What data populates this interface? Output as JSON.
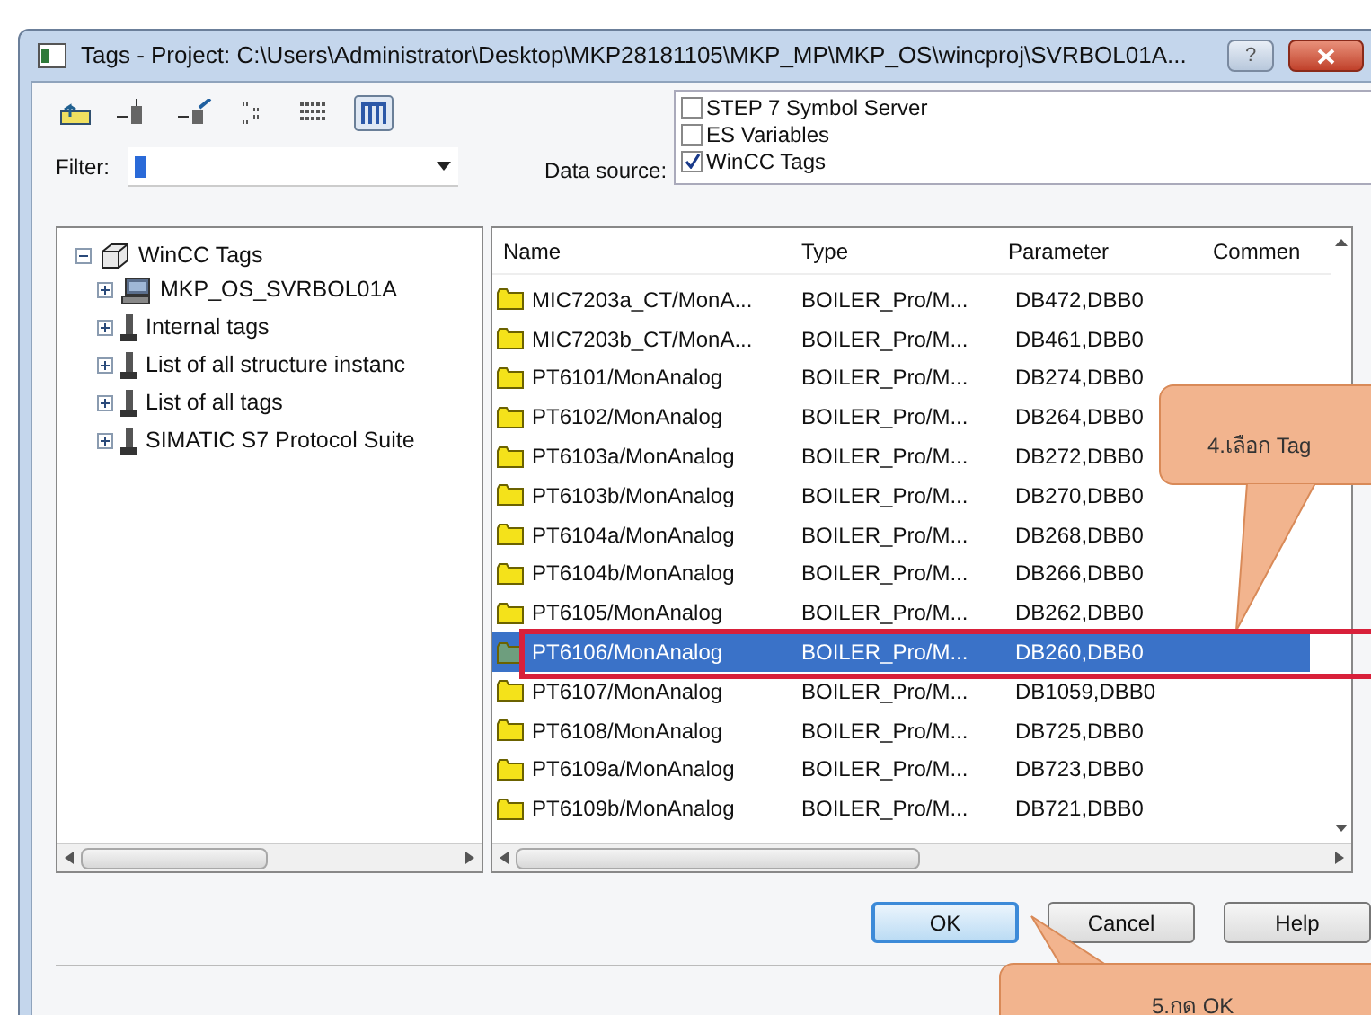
{
  "window": {
    "title": "Tags - Project: C:\\Users\\Administrator\\Desktop\\MKP28181105\\MKP_MP\\MKP_OS\\wincproj\\SVRBOL01A...",
    "help_glyph": "?"
  },
  "filter": {
    "label": "Filter:"
  },
  "data_source": {
    "label": "Data source:",
    "options": [
      {
        "label": "STEP 7 Symbol Server",
        "checked": false
      },
      {
        "label": "ES Variables",
        "checked": false
      },
      {
        "label": "WinCC Tags",
        "checked": true
      }
    ]
  },
  "tree": {
    "label": "WinCC Tags",
    "expanded": true,
    "children": [
      {
        "label": "MKP_OS_SVRBOL01A",
        "kind": "computer",
        "expanded": false
      },
      {
        "label": "Internal tags",
        "kind": "connection",
        "expanded": false
      },
      {
        "label": "List of all structure instanc",
        "kind": "connection",
        "expanded": false
      },
      {
        "label": "List of all tags",
        "kind": "connection",
        "expanded": false
      },
      {
        "label": "SIMATIC S7 Protocol Suite",
        "kind": "connection",
        "expanded": false
      }
    ]
  },
  "table": {
    "columns": [
      "Name",
      "Type",
      "Parameter",
      "Commen"
    ],
    "rows": [
      {
        "name": "MIC7203a_CT/MonA...",
        "type": "BOILER_Pro/M...",
        "parameter": "DB472,DBB0",
        "selected": false
      },
      {
        "name": "MIC7203b_CT/MonA...",
        "type": "BOILER_Pro/M...",
        "parameter": "DB461,DBB0",
        "selected": false
      },
      {
        "name": "PT6101/MonAnalog",
        "type": "BOILER_Pro/M...",
        "parameter": "DB274,DBB0",
        "selected": false
      },
      {
        "name": "PT6102/MonAnalog",
        "type": "BOILER_Pro/M...",
        "parameter": "DB264,DBB0",
        "selected": false
      },
      {
        "name": "PT6103a/MonAnalog",
        "type": "BOILER_Pro/M...",
        "parameter": "DB272,DBB0",
        "selected": false
      },
      {
        "name": "PT6103b/MonAnalog",
        "type": "BOILER_Pro/M...",
        "parameter": "DB270,DBB0",
        "selected": false
      },
      {
        "name": "PT6104a/MonAnalog",
        "type": "BOILER_Pro/M...",
        "parameter": "DB268,DBB0",
        "selected": false
      },
      {
        "name": "PT6104b/MonAnalog",
        "type": "BOILER_Pro/M...",
        "parameter": "DB266,DBB0",
        "selected": false
      },
      {
        "name": "PT6105/MonAnalog",
        "type": "BOILER_Pro/M...",
        "parameter": "DB262,DBB0",
        "selected": false
      },
      {
        "name": "PT6106/MonAnalog",
        "type": "BOILER_Pro/M...",
        "parameter": "DB260,DBB0",
        "selected": true
      },
      {
        "name": "PT6107/MonAnalog",
        "type": "BOILER_Pro/M...",
        "parameter": "DB1059,DBB0",
        "selected": false
      },
      {
        "name": "PT6108/MonAnalog",
        "type": "BOILER_Pro/M...",
        "parameter": "DB725,DBB0",
        "selected": false
      },
      {
        "name": "PT6109a/MonAnalog",
        "type": "BOILER_Pro/M...",
        "parameter": "DB723,DBB0",
        "selected": false
      },
      {
        "name": "PT6109b/MonAnalog",
        "type": "BOILER_Pro/M...",
        "parameter": "DB721,DBB0",
        "selected": false
      }
    ]
  },
  "buttons": [
    {
      "label": "OK",
      "default": true
    },
    {
      "label": "Cancel",
      "default": false
    },
    {
      "label": "Help",
      "default": false
    }
  ],
  "callouts": [
    {
      "text": "4.เลือก Tag"
    },
    {
      "text": "5.กด OK"
    }
  ]
}
